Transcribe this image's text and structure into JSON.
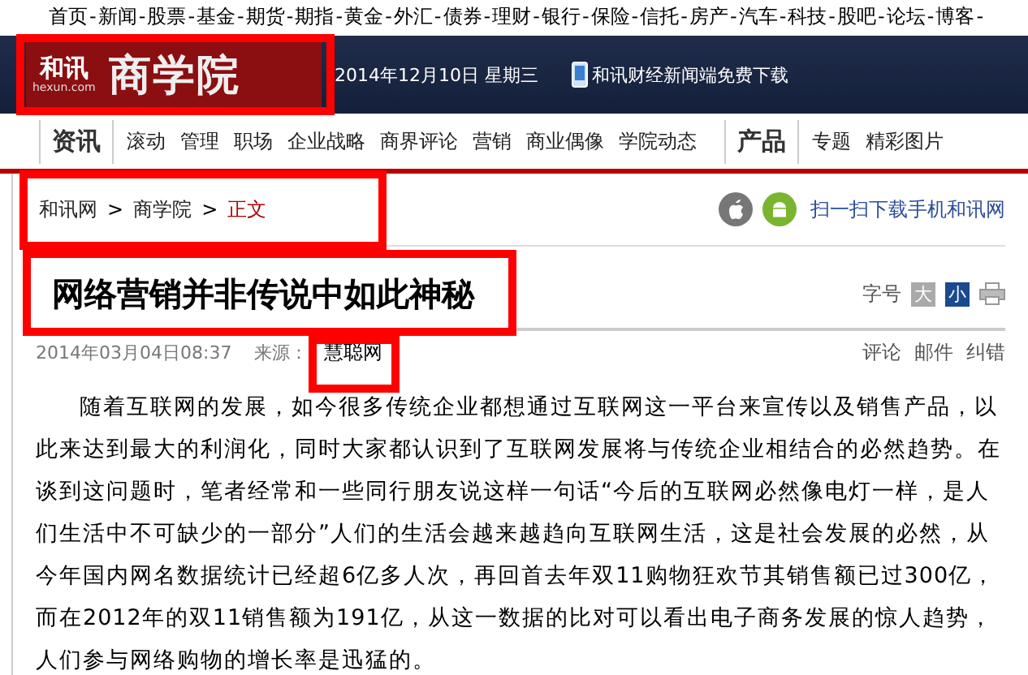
{
  "top_nav": {
    "items": [
      "首页",
      "新闻",
      "股票",
      "基金",
      "期货",
      "期指",
      "黄金",
      "外汇",
      "债券",
      "理财",
      "银行",
      "保险",
      "信托",
      "房产",
      "汽车",
      "科技",
      "股吧",
      "论坛",
      "博客"
    ],
    "separator": "-"
  },
  "header": {
    "logo": {
      "brand": "和讯",
      "domain": "hexun.com",
      "section": "商学院",
      "highlighted": true
    },
    "date": "2014年12月10日  星期三",
    "app_link": "和讯财经新闻端免费下载"
  },
  "channel_nav": {
    "groups": [
      {
        "title": "资讯",
        "items": [
          "滚动",
          "管理",
          "职场",
          "企业战略",
          "商界评论",
          "营销",
          "商业偶像",
          "学院动态"
        ]
      },
      {
        "title": "产品",
        "items": [
          "专题",
          "精彩图片"
        ]
      }
    ]
  },
  "breadcrumb": {
    "items": [
      {
        "label": "和讯网",
        "current": false
      },
      {
        "label": "商学院",
        "current": false
      },
      {
        "label": "正文",
        "current": true
      }
    ],
    "separator": ">",
    "highlighted": true
  },
  "mobile_promo": "扫一扫下载手机和讯网",
  "article": {
    "title": "网络营销并非传说中如此神秘",
    "title_highlighted": true,
    "font_size_label": "字号",
    "font_sizes": [
      {
        "label": "大",
        "selected": false
      },
      {
        "label": "小",
        "selected": true
      }
    ],
    "date": "2014年03月04日08:37",
    "source_label": "来源：",
    "source": "慧聪网",
    "source_highlighted": true,
    "actions": [
      "评论",
      "邮件",
      "纠错"
    ],
    "body": "随着互联网的发展，如今很多传统企业都想通过互联网这一平台来宣传以及销售产品，以此来达到最大的利润化，同时大家都认识到了互联网发展将与传统企业相结合的必然趋势。在谈到这问题时，笔者经常和一些同行朋友说这样一句话“今后的互联网必然像电灯一样，是人们生活中不可缺少的一部分”人们的生活会越来越趋向互联网生活，这是社会发展的必然，从今年国内网名数据统计已经超6亿多人次，再回首去年双11购物狂欢节其销售额已过300亿，而在2012年的双11销售额为191亿，从这一数据的比对可以看出电子商务发展的惊人趋势，人们参与网络购物的增长率是迅猛的。"
  }
}
